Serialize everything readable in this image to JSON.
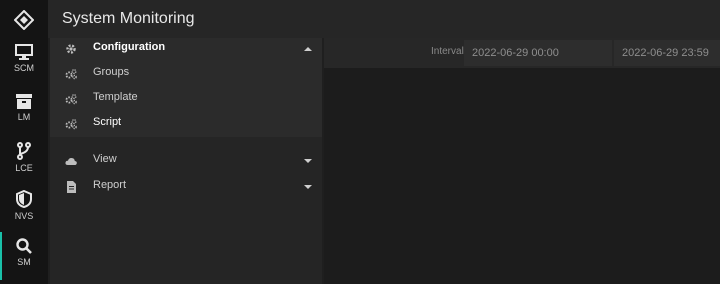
{
  "app": {
    "title": "System Monitoring"
  },
  "rail": [
    {
      "name": "SCM",
      "icon": "monitor-icon"
    },
    {
      "name": "LM",
      "icon": "archive-box-icon"
    },
    {
      "name": "LCE",
      "icon": "branch-icon"
    },
    {
      "name": "NVS",
      "icon": "shield-icon"
    },
    {
      "name": "SM",
      "icon": "search-icon",
      "active": true
    }
  ],
  "menu": {
    "configuration": {
      "label": "Configuration",
      "icon": "gear-icon",
      "expanded": true
    },
    "config_items": [
      {
        "label": "Groups",
        "icon": "gears-icon"
      },
      {
        "label": "Template",
        "icon": "gears-icon"
      },
      {
        "label": "Script",
        "icon": "gears-icon"
      }
    ],
    "view": {
      "label": "View",
      "icon": "cloud-icon"
    },
    "report": {
      "label": "Report",
      "icon": "document-icon"
    }
  },
  "filter": {
    "interval_label": "Interval",
    "start": "2022-06-29 00:00",
    "end": "2022-06-29 23:59"
  },
  "colors": {
    "accent": "#19c0a8"
  }
}
